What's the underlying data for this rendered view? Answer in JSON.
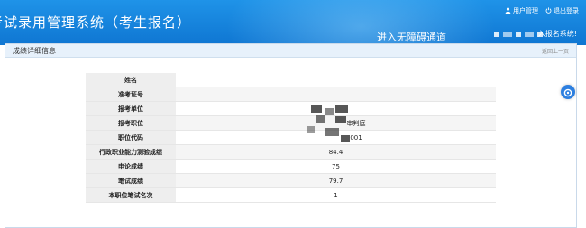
{
  "header": {
    "system_title": "考试录用管理系统（考生报名）",
    "user_manage": "用户管理",
    "logout": "退出登录",
    "accessible_channel": "进入无障碍通道",
    "gateway": "入报名系统!"
  },
  "panel": {
    "title": "成绩详细信息",
    "back": "返回上一页"
  },
  "table": {
    "rows": [
      {
        "label": "姓名",
        "value": ""
      },
      {
        "label": "准考证号",
        "value": ""
      },
      {
        "label": "报考单位",
        "value": ""
      },
      {
        "label": "报考职位",
        "value": "审判庭"
      },
      {
        "label": "职位代码",
        "value": "001"
      },
      {
        "label": "行政职业能力测验成绩",
        "value": "84.4"
      },
      {
        "label": "申论成绩",
        "value": "75"
      },
      {
        "label": "笔试成绩",
        "value": "79.7"
      },
      {
        "label": "本职位笔试名次",
        "value": "1"
      }
    ]
  },
  "colors": {
    "header_blue": "#1784dc",
    "panel_head": "#e7f1fb",
    "label_bg": "#eeeeee"
  },
  "icons": [
    "user-icon",
    "power-icon",
    "chat-icon"
  ]
}
